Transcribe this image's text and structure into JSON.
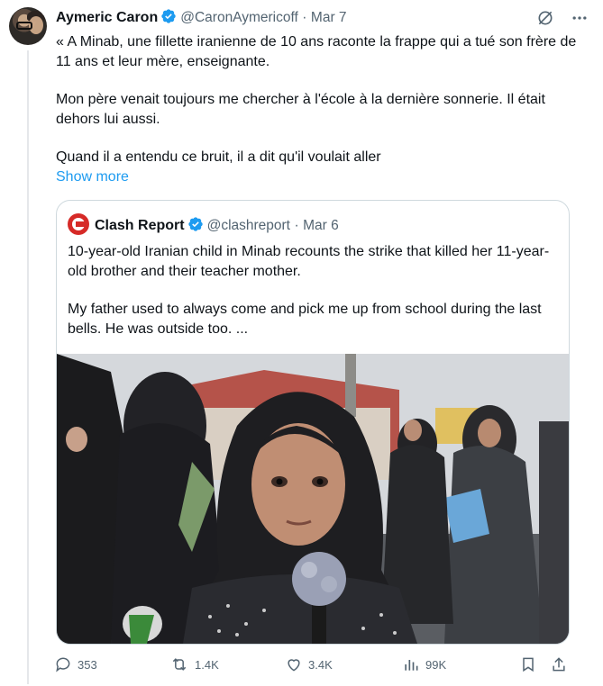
{
  "author": {
    "name": "Aymeric Caron",
    "handle": "@CaronAymericoff",
    "separator": "·",
    "date": "Mar 7"
  },
  "tweet": {
    "paragraphs": [
      "« A Minab, une fillette iranienne de 10 ans raconte la frappe qui a tué son frère de 11 ans et leur mère, enseignante.",
      "Mon père venait toujours me chercher à l'école à la dernière sonnerie. Il était dehors lui aussi.",
      "Quand il a entendu ce bruit, il a dit qu'il voulait aller"
    ],
    "show_more": "Show more"
  },
  "quote": {
    "name": "Clash Report",
    "handle": "@clashreport",
    "separator": "·",
    "date": "Mar 6",
    "paragraphs": [
      "10-year-old Iranian child in Minab recounts the strike that killed her 11-year-old brother and their teacher mother.",
      "My father used to always come and pick me up from school during the last bells. He was outside too. ..."
    ]
  },
  "actions": {
    "replies": "353",
    "reposts": "1.4K",
    "likes": "3.4K",
    "views": "99K"
  },
  "icons": [
    "verified-badge-icon",
    "grok-icon",
    "more-icon",
    "reply-icon",
    "repost-icon",
    "like-icon",
    "views-icon",
    "bookmark-icon",
    "share-icon"
  ],
  "colors": {
    "text": "#0f1419",
    "secondary": "#536471",
    "link": "#1d9bf0",
    "verified": "#1d9bf0",
    "border": "#cfd9de"
  }
}
